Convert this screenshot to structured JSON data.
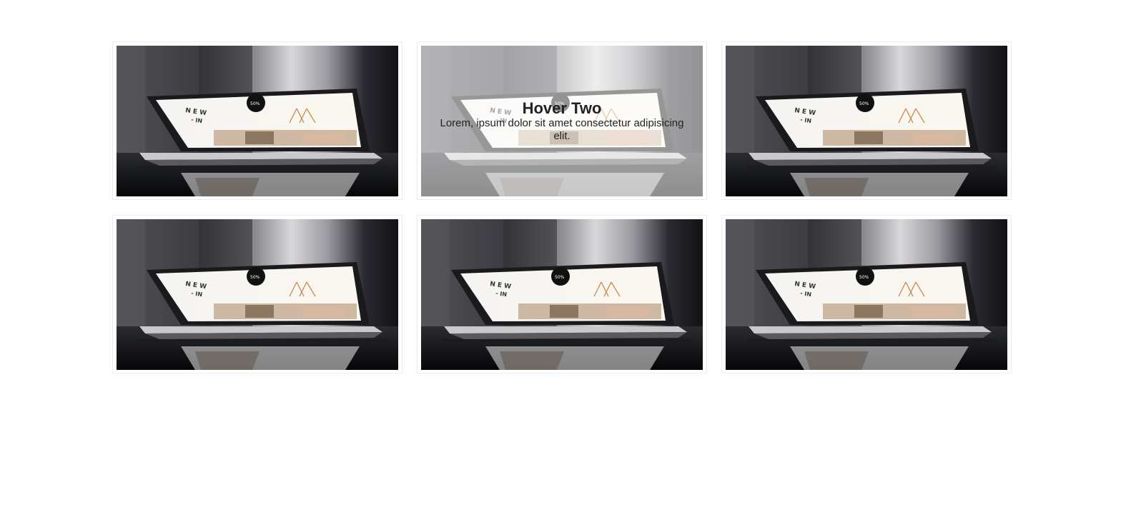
{
  "gallery": {
    "items": [
      {
        "image": "laptop-photo",
        "hovered": false
      },
      {
        "image": "laptop-photo",
        "hovered": true,
        "title": "Hover Two",
        "text": "Lorem, ipsum dolor sit amet consectetur adipisicing elit."
      },
      {
        "image": "laptop-photo",
        "hovered": false
      },
      {
        "image": "laptop-photo",
        "hovered": false
      },
      {
        "image": "laptop-photo",
        "hovered": false
      },
      {
        "image": "laptop-photo",
        "hovered": false
      }
    ]
  },
  "colors": {
    "overlay": "#ffffff",
    "text": "#222222",
    "card_border": "#ececec"
  }
}
